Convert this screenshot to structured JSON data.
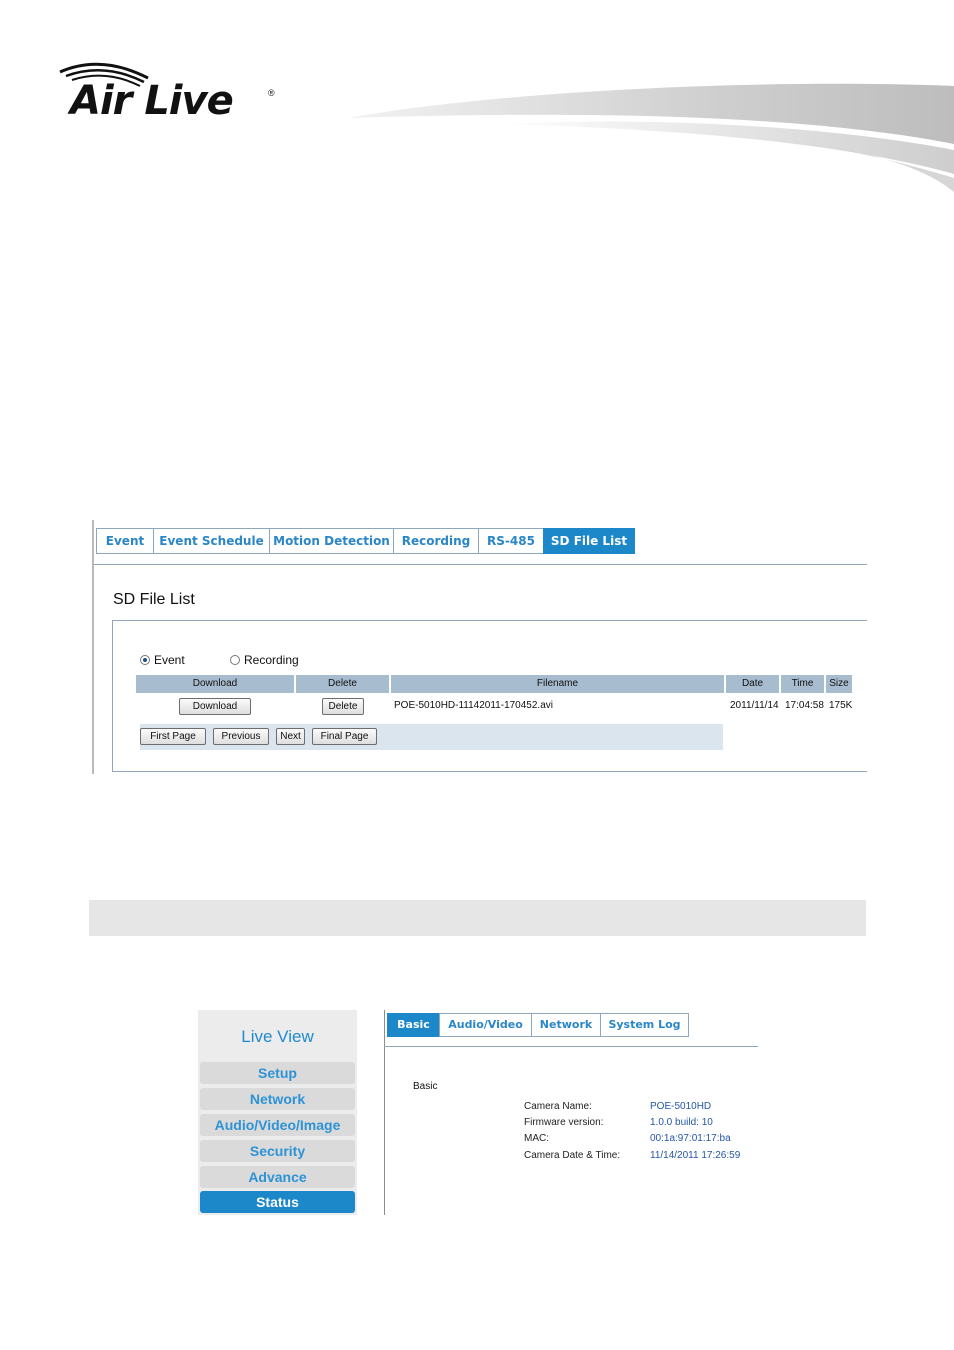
{
  "brand": {
    "logo_text": "Air Live",
    "registered_mark": "®"
  },
  "sd_file_list": {
    "tabs": [
      {
        "label": "Event",
        "active": false
      },
      {
        "label": "Event Schedule",
        "active": false
      },
      {
        "label": "Motion Detection",
        "active": false
      },
      {
        "label": "Recording",
        "active": false
      },
      {
        "label": "RS-485",
        "active": false
      },
      {
        "label": "SD File List",
        "active": true
      }
    ],
    "title": "SD File List",
    "source_options": [
      {
        "label": "Event",
        "selected": true
      },
      {
        "label": "Recording",
        "selected": false
      }
    ],
    "columns": [
      "Download",
      "Delete",
      "Filename",
      "Date",
      "Time",
      "Size"
    ],
    "rows": [
      {
        "download_button": "Download",
        "delete_button": "Delete",
        "filename": "POE-5010HD-11142011-170452.avi",
        "date": "2011/11/14",
        "time": "17:04:58",
        "size": "175K"
      }
    ],
    "pager": {
      "first": "First Page",
      "previous": "Previous",
      "next": "Next",
      "final": "Final Page"
    }
  },
  "status_page": {
    "sidebar": {
      "title": "Live View",
      "items": [
        {
          "label": "Setup",
          "active": false
        },
        {
          "label": "Network",
          "active": false
        },
        {
          "label": "Audio/Video/Image",
          "active": false
        },
        {
          "label": "Security",
          "active": false
        },
        {
          "label": "Advance",
          "active": false
        },
        {
          "label": "Status",
          "active": true
        }
      ]
    },
    "tabs": [
      {
        "label": "Basic",
        "active": true
      },
      {
        "label": "Audio/Video",
        "active": false
      },
      {
        "label": "Network",
        "active": false
      },
      {
        "label": "System Log",
        "active": false
      }
    ],
    "section_title": "Basic",
    "fields": [
      {
        "label": "Camera Name:",
        "value": "POE-5010HD"
      },
      {
        "label": "Firmware version:",
        "value": "1.0.0 build: 10"
      },
      {
        "label": "MAC:",
        "value": "00:1a:97:01:17:ba"
      },
      {
        "label": "Camera Date & Time:",
        "value": "11/14/2011 17:26:59"
      }
    ]
  },
  "colors": {
    "accent": "#1c88c9",
    "tab_text": "#2a86c6",
    "table_header": "#a7bccf",
    "sidebar_bg": "#ececec",
    "value_text": "#2456a8"
  }
}
